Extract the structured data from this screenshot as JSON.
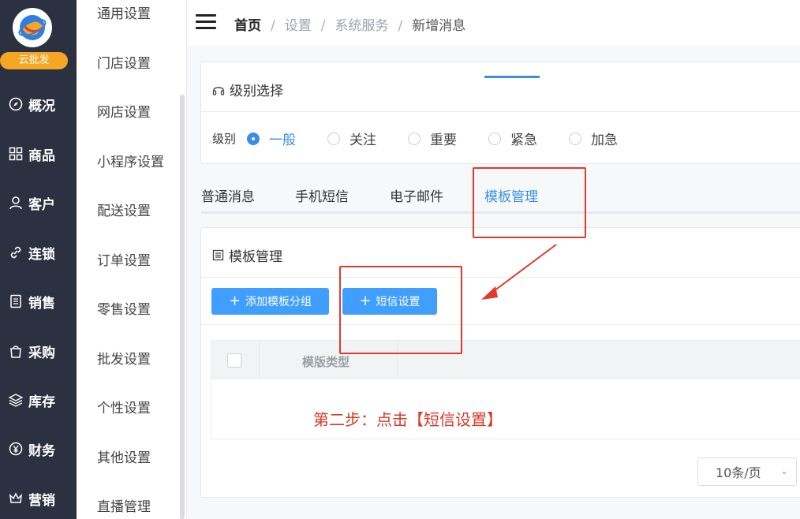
{
  "brand": {
    "name": "云批发"
  },
  "nav": {
    "items": [
      {
        "label": "概况",
        "icon": "compass-icon"
      },
      {
        "label": "商品",
        "icon": "grid-icon"
      },
      {
        "label": "客户",
        "icon": "user-icon"
      },
      {
        "label": "连锁",
        "icon": "link-icon"
      },
      {
        "label": "销售",
        "icon": "document-icon"
      },
      {
        "label": "采购",
        "icon": "bag-icon"
      },
      {
        "label": "库存",
        "icon": "layers-icon"
      },
      {
        "label": "财务",
        "icon": "yen-icon"
      },
      {
        "label": "营销",
        "icon": "crown-icon"
      }
    ]
  },
  "subnav": {
    "items": [
      "通用设置",
      "门店设置",
      "网店设置",
      "小程序设置",
      "配送设置",
      "订单设置",
      "零售设置",
      "批发设置",
      "个性设置",
      "其他设置",
      "直播管理"
    ]
  },
  "breadcrumb": {
    "home": "首页",
    "sep": "/",
    "level1": "设置",
    "level2": "系统服务",
    "current": "新增消息"
  },
  "level_card": {
    "title": "级别选择",
    "label": "级别",
    "options": [
      "一般",
      "关注",
      "重要",
      "紧急",
      "加急"
    ],
    "selected": "一般"
  },
  "tabs": {
    "items": [
      "普通消息",
      "手机短信",
      "电子邮件",
      "模板管理"
    ],
    "active": "模板管理"
  },
  "template_card": {
    "title": "模板管理",
    "add_group_label": "添加模板分组",
    "sms_settings_label": "短信设置",
    "column_type": "模版类型"
  },
  "annotation": {
    "text": "第二步：点击【短信设置】"
  },
  "pagination": {
    "page_size": "10条/页"
  },
  "colors": {
    "accent": "#409eff",
    "nav_bg": "#2b3140",
    "brand": "#f5a623",
    "annotation": "#d63a2b"
  }
}
